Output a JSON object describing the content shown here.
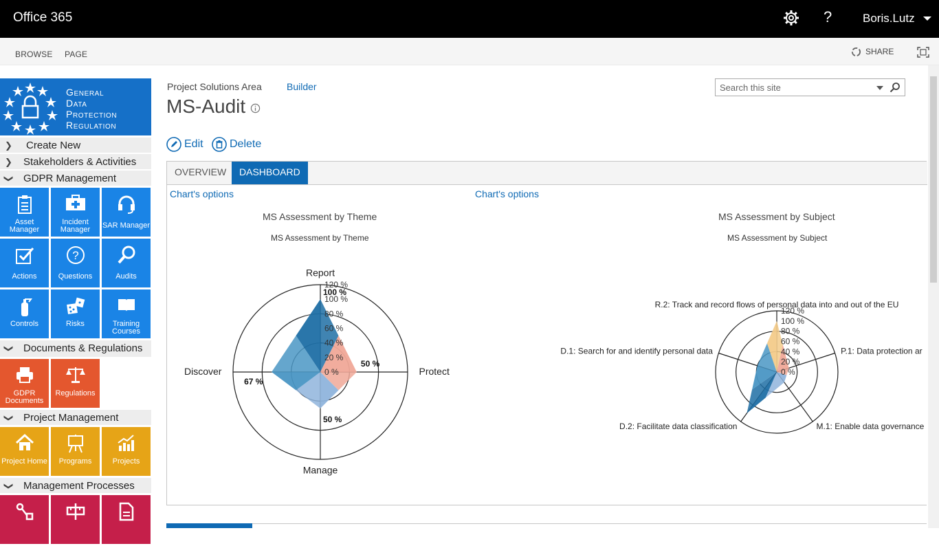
{
  "suitebar": {
    "brand": "Office 365",
    "user": "Boris.Lutz",
    "help": "?"
  },
  "ribbon": {
    "tabs": [
      "BROWSE",
      "PAGE"
    ],
    "share": "SHARE"
  },
  "logo": {
    "lines": [
      "General",
      "Data",
      "Protection",
      "Regulation"
    ]
  },
  "nav": {
    "create_new": "Create New",
    "stakeholders": "Stakeholders & Activities",
    "gdpr_management": "GDPR Management",
    "gdpr_tiles": [
      {
        "label1": "Asset",
        "label2": "Manager",
        "icon": "clipboard-icon"
      },
      {
        "label1": "Incident",
        "label2": "Manager",
        "icon": "first-aid-icon"
      },
      {
        "label1": "",
        "label2": "SAR Manager",
        "icon": "headset-icon"
      },
      {
        "label1": "",
        "label2": "Actions",
        "icon": "checkbox-icon"
      },
      {
        "label1": "",
        "label2": "Questions",
        "icon": "question-icon"
      },
      {
        "label1": "",
        "label2": "Audits",
        "icon": "magnifier-icon"
      },
      {
        "label1": "",
        "label2": "Controls",
        "icon": "extinguisher-icon"
      },
      {
        "label1": "",
        "label2": "Risks",
        "icon": "dice-icon"
      },
      {
        "label1": "Training",
        "label2": "Courses",
        "icon": "book-icon"
      }
    ],
    "documents": "Documents & Regulations",
    "doc_tiles": [
      {
        "label1": "GDPR",
        "label2": "Documents",
        "icon": "printer-icon"
      },
      {
        "label1": "",
        "label2": "Regulations",
        "icon": "scale-icon"
      }
    ],
    "project_management": "Project Management",
    "pm_tiles": [
      {
        "label": "Project Home",
        "icon": "home-icon"
      },
      {
        "label": "Programs",
        "icon": "easel-icon"
      },
      {
        "label": "Projects",
        "icon": "chart-up-icon"
      }
    ],
    "management_processes": "Management Processes"
  },
  "main": {
    "crumb": "Project Solutions Area",
    "crumb_link": "Builder",
    "title": "MS-Audit",
    "search_placeholder": "Search this site",
    "edit": "Edit",
    "delete": "Delete",
    "tabs": [
      "OVERVIEW",
      "DASHBOARD"
    ],
    "chart_options": "Chart's options"
  },
  "chart_data": [
    {
      "type": "radar",
      "title": "MS Assessment by Theme",
      "subtitle": "MS Assessment by Theme",
      "axes": [
        "Report",
        "Protect",
        "Manage",
        "Discover"
      ],
      "ticks": [
        "0 %",
        "20 %",
        "40 %",
        "60 %",
        "80 %",
        "100 %",
        "120 %"
      ],
      "rmax": 120,
      "series": [
        {
          "values": [
            100,
            50,
            50,
            67
          ],
          "color": "#1f6fa5"
        }
      ],
      "data_labels": [
        "100 %",
        "50 %",
        "50 %",
        "67 %"
      ]
    },
    {
      "type": "radar",
      "title": "MS Assessment by Subject",
      "subtitle": "MS Assessment by Subject",
      "axes": [
        "R.2: Track and record flows of personal data into and out of the EU",
        "P.1: Data protection ar",
        "M.1: Enable data governance",
        "D.2: Facilitate data classification",
        "D.1: Search for and identify personal data"
      ],
      "ticks": [
        "0 %",
        "20 %",
        "40 %",
        "60 %",
        "80 %",
        "100 %",
        "120 %"
      ],
      "rmax": 120,
      "series": [
        {
          "values": [
            100,
            25,
            25,
            100,
            40
          ],
          "color": "#1f6fa5"
        }
      ]
    }
  ]
}
